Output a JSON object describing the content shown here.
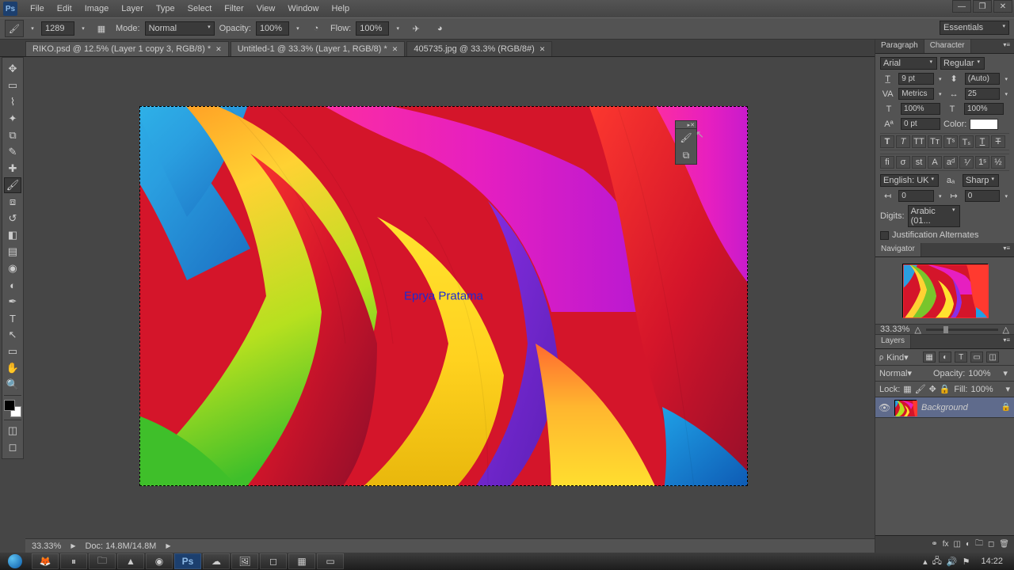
{
  "menu": {
    "items": [
      "File",
      "Edit",
      "Image",
      "Layer",
      "Type",
      "Select",
      "Filter",
      "View",
      "Window",
      "Help"
    ],
    "logo": "Ps"
  },
  "optbar": {
    "brush_size": "1289",
    "mode_label": "Mode:",
    "mode_val": "Normal",
    "opacity_label": "Opacity:",
    "opacity_val": "100%",
    "flow_label": "Flow:",
    "flow_val": "100%"
  },
  "workspace": "Essentials",
  "tabs": [
    {
      "label": "RIKO.psd @ 12.5% (Layer 1 copy 3, RGB/8) *",
      "active": false
    },
    {
      "label": "Untitled-1 @ 33.3% (Layer 1, RGB/8) *",
      "active": false
    },
    {
      "label": "405735.jpg @ 33.3% (RGB/8#)",
      "active": true
    }
  ],
  "canvas": {
    "watermark": "Eprya Pratama"
  },
  "char": {
    "tab1": "Paragraph",
    "tab2": "Character",
    "font": "Arial",
    "style": "Regular",
    "size": "9 pt",
    "leading": "(Auto)",
    "kerning": "Metrics",
    "tracking": "25",
    "vscale": "100%",
    "hscale": "100%",
    "baseline": "0 pt",
    "color_label": "Color:",
    "lang": "English: UK",
    "aa": "Sharp",
    "kern2a": "0",
    "kern2b": "0",
    "digits_label": "Digits:",
    "digits_val": "Arabic (01...",
    "justalt": "Justification Alternates"
  },
  "nav": {
    "title": "Navigator",
    "zoom": "33.33%"
  },
  "layers": {
    "title": "Layers",
    "kind": "Kind",
    "blend": "Normal",
    "opacity_label": "Opacity:",
    "opacity_val": "100%",
    "lock_label": "Lock:",
    "fill_label": "Fill:",
    "fill_val": "100%",
    "layer_name": "Background"
  },
  "status": {
    "zoom": "33.33%",
    "doc": "Doc: 14.8M/14.8M"
  },
  "taskbar": {
    "clock": "14:22"
  }
}
